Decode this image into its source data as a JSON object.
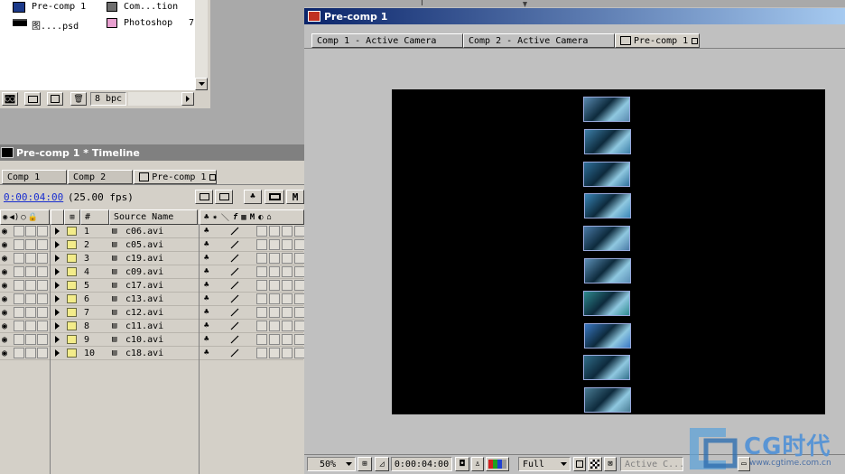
{
  "project": {
    "items": [
      {
        "name": "Pre-comp 1",
        "type": "Com...tion",
        "type_color": "#6e6e6e"
      },
      {
        "name": "图....psd",
        "type": "Photoshop",
        "type_color": "#e8a0d0",
        "extra": "7"
      }
    ],
    "bpc": "8 bpc"
  },
  "timeline": {
    "title": "Pre-comp 1 * Timeline",
    "tabs": [
      "Comp 1",
      "Comp 2",
      "Pre-comp 1"
    ],
    "timecode": "0:00:04:00",
    "fps": "(25.00 fps)",
    "col_number": "#",
    "col_source": "Source Name",
    "layers": [
      {
        "num": "1",
        "name": "c06.avi"
      },
      {
        "num": "2",
        "name": "c05.avi"
      },
      {
        "num": "3",
        "name": "c19.avi"
      },
      {
        "num": "4",
        "name": "c09.avi"
      },
      {
        "num": "5",
        "name": "c17.avi"
      },
      {
        "num": "6",
        "name": "c13.avi"
      },
      {
        "num": "7",
        "name": "c12.avi"
      },
      {
        "num": "8",
        "name": "c11.avi"
      },
      {
        "num": "9",
        "name": "c10.avi"
      },
      {
        "num": "10",
        "name": "c18.avi"
      }
    ]
  },
  "comp": {
    "title": "Pre-comp 1",
    "tabs": [
      "Comp 1 - Active Camera",
      "Comp 2 - Active Camera",
      "Pre-comp 1"
    ],
    "zoom": "50%",
    "timecode": "0:00:04:00",
    "resolution": "Full",
    "view": "Active C..."
  },
  "watermark": {
    "brand": "CG时代",
    "url": "www.cgtime.com.cn"
  },
  "colors": {
    "title_active_start": "#0a246a",
    "title_active_end": "#a6caf0",
    "title_inactive": "#808080",
    "label_yellow": "#f3ec8a",
    "thumb_tint": "#3a8fb8"
  }
}
